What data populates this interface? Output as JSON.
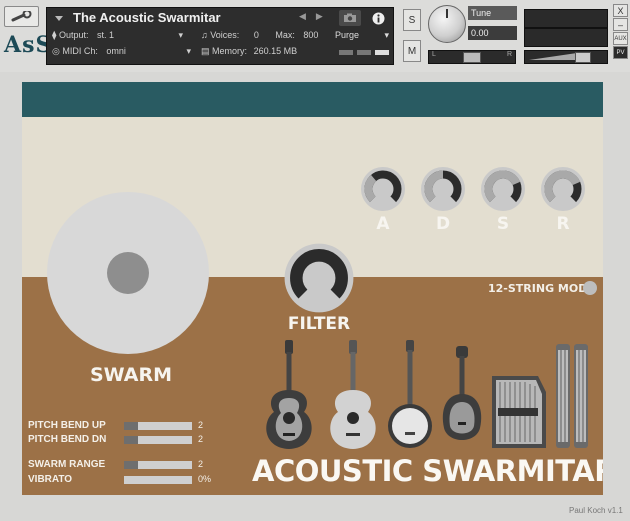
{
  "header": {
    "instrument_name": "The Acoustic Swarmitar",
    "output_label": "Output:",
    "output_value": "st. 1",
    "midi_label": "MIDI Ch:",
    "midi_value": "omni",
    "voices_label": "Voices:",
    "voices_value": "0",
    "max_label": "Max:",
    "max_value": "800",
    "memory_label": "Memory:",
    "memory_value": "260.15 MB",
    "purge_label": "Purge",
    "solo_label": "S",
    "mute_label": "M",
    "tune_label": "Tune",
    "tune_value": "0.00",
    "pan_left": "L",
    "pan_right": "R",
    "aux_label": "AUX",
    "pv_label": "PV",
    "close_label": "X",
    "minimize_label": "–",
    "logo_text": "AꜱS"
  },
  "colors": {
    "teal": "#295b62",
    "cream": "#e3ded0",
    "brown": "#9c7147",
    "knob_dark": "#2b2b2b",
    "knob_ring": "#a9a9a9"
  },
  "envelope": {
    "knobs": [
      {
        "label": "A",
        "value": 0.35
      },
      {
        "label": "D",
        "value": 0.5
      },
      {
        "label": "S",
        "value": 0.75
      },
      {
        "label": "R",
        "value": 0.75
      }
    ]
  },
  "filter": {
    "label": "FILTER",
    "value": 1.0
  },
  "swarm": {
    "label": "SWARM"
  },
  "twelve_string": {
    "label": "12-STRING MODE",
    "on": false
  },
  "sliders": {
    "pitch_bend_up": {
      "label": "PITCH BEND UP",
      "value": "2",
      "fill": 0.2
    },
    "pitch_bend_dn": {
      "label": "PITCH BEND DN",
      "value": "2",
      "fill": 0.2
    },
    "swarm_range": {
      "label": "SWARM RANGE",
      "value": "2",
      "fill": 0.2
    },
    "vibrato": {
      "label": "VIBRATO",
      "value": "0%",
      "fill": 0.0
    }
  },
  "brand_title": "ACOUSTIC SWARMITAR",
  "credit": "Paul Koch v1.1",
  "instruments": [
    {
      "name": "acoustic-guitar-sunburst-icon"
    },
    {
      "name": "acoustic-guitar-natural-icon"
    },
    {
      "name": "banjo-icon"
    },
    {
      "name": "mandolin-icon"
    },
    {
      "name": "autoharp-icon"
    },
    {
      "name": "double-neck-dulcimer-icon"
    }
  ]
}
